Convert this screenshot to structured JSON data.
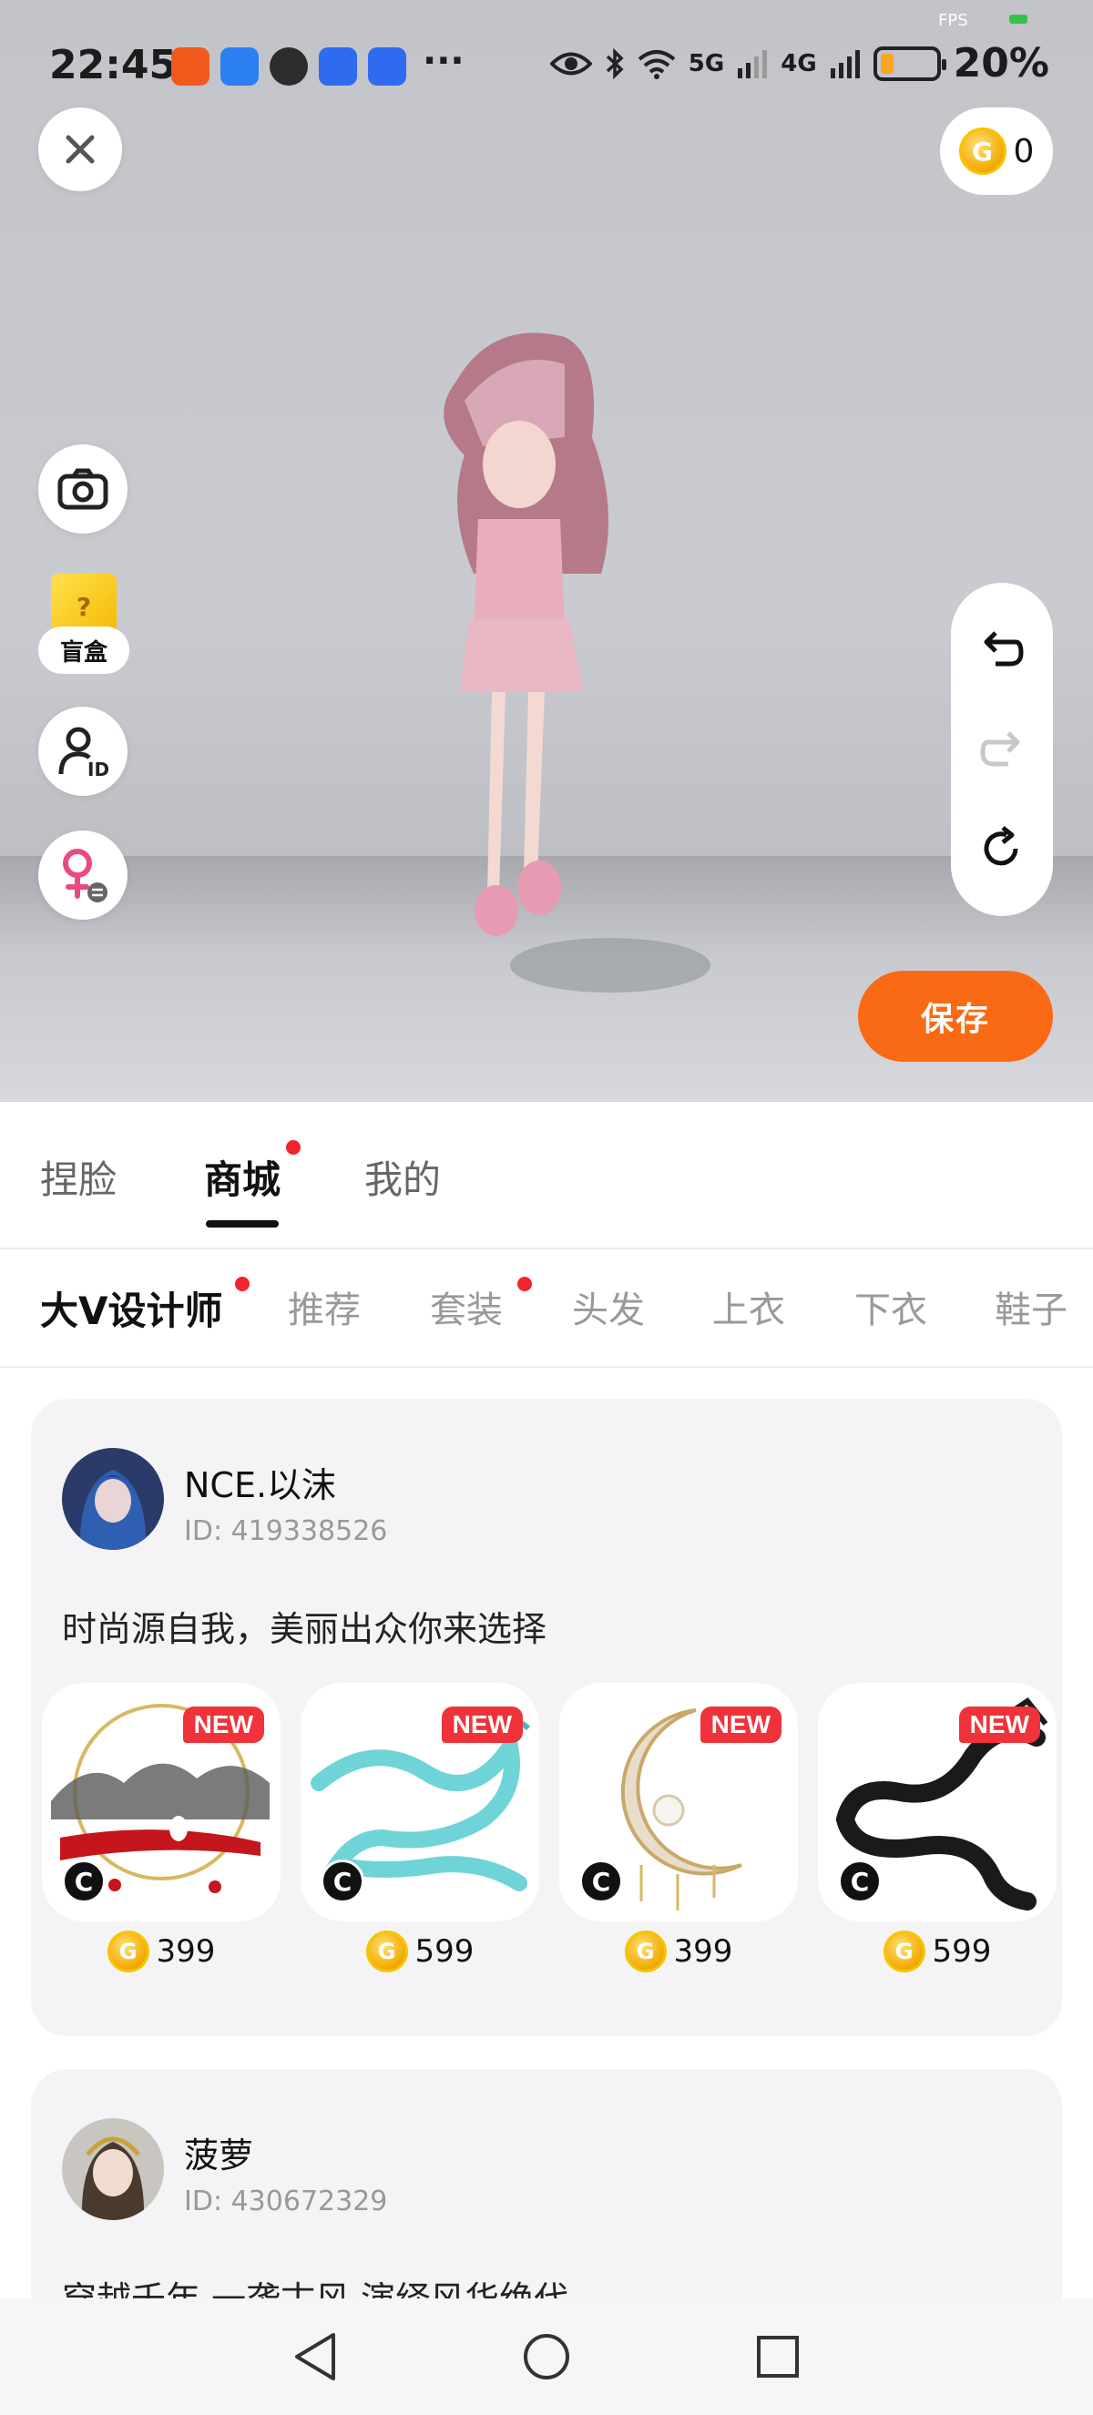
{
  "status_bar": {
    "time": "22:45",
    "more": "···",
    "network_5g": "5G",
    "network_4g": "4G",
    "battery_pct": "20%",
    "fps_label": "FPS"
  },
  "viewport": {
    "coin_balance": "0",
    "blind_box_label": "盲盒",
    "save_label": "保存"
  },
  "main_tabs": [
    {
      "label": "捏脸"
    },
    {
      "label": "商城"
    },
    {
      "label": "我的"
    }
  ],
  "sub_tabs": [
    {
      "label": "大V设计师"
    },
    {
      "label": "推荐"
    },
    {
      "label": "套装"
    },
    {
      "label": "头发"
    },
    {
      "label": "上衣"
    },
    {
      "label": "下衣"
    },
    {
      "label": "鞋子"
    }
  ],
  "designers": [
    {
      "name": "NCE.以沫",
      "id": "ID: 419338526",
      "desc": "时尚源自我，美丽出众你来选择",
      "items": [
        {
          "badge": "NEW",
          "price": "399",
          "icon": "ink-landscape-halo-icon"
        },
        {
          "badge": "NEW",
          "price": "599",
          "icon": "cyan-dragon-icon"
        },
        {
          "badge": "NEW",
          "price": "399",
          "icon": "crescent-moon-icon"
        },
        {
          "badge": "NEW",
          "price": "599",
          "icon": "black-dragon-icon"
        }
      ]
    },
    {
      "name": "菠萝",
      "id": "ID: 430672329",
      "desc": "穿越千年 一袭古风 演绎风华绝代"
    }
  ],
  "colors": {
    "accent_orange": "#fa6a14",
    "badge_red": "#f0323a",
    "coin_gold": "#f2a900",
    "dot_red": "#f2242b"
  }
}
